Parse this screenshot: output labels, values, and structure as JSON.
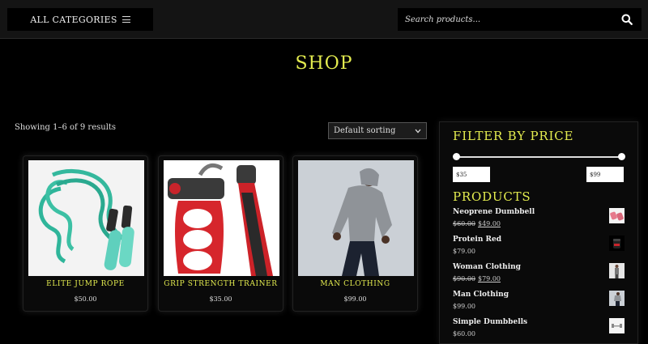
{
  "header": {
    "categories_label": "ALL CATEGORIES",
    "search_placeholder": "Search products..."
  },
  "page_title": "SHOP",
  "results": {
    "count_text": "Showing 1–6 of 9 results",
    "sort_selected": "Default sorting"
  },
  "products": [
    {
      "name": "ELITE JUMP ROPE",
      "price": "$50.00",
      "icon": "jump-rope"
    },
    {
      "name": "GRIP STRENGTH TRAINER",
      "price": "$35.00",
      "icon": "hand-gripper"
    },
    {
      "name": "MAN CLOTHING",
      "price": "$99.00",
      "icon": "man-running-photo"
    }
  ],
  "sidebar": {
    "filter_heading": "FILTER BY PRICE",
    "price_min": "$35",
    "price_max": "$99",
    "slider_min_fraction": 0,
    "slider_max_fraction": 1,
    "products_heading": "PRODUCTS",
    "items": [
      {
        "name": "Neoprene Dumbbell",
        "old_price": "$60.00",
        "new_price": "$49.00",
        "icon": "pink-dumbbell"
      },
      {
        "name": "Protein Red",
        "old_price": "",
        "new_price": "$79.00",
        "icon": "protein-jar"
      },
      {
        "name": "Woman Clothing",
        "old_price": "$90.00",
        "new_price": "$79.00",
        "icon": "woman-clothing"
      },
      {
        "name": "Man Clothing",
        "old_price": "",
        "new_price": "$99.00",
        "icon": "man-clothing"
      },
      {
        "name": "Simple Dumbbells",
        "old_price": "",
        "new_price": "$60.00",
        "icon": "dumbbells"
      }
    ]
  },
  "colors": {
    "accent": "#e4ec4f",
    "background": "#000000",
    "topbar": "#141414"
  }
}
